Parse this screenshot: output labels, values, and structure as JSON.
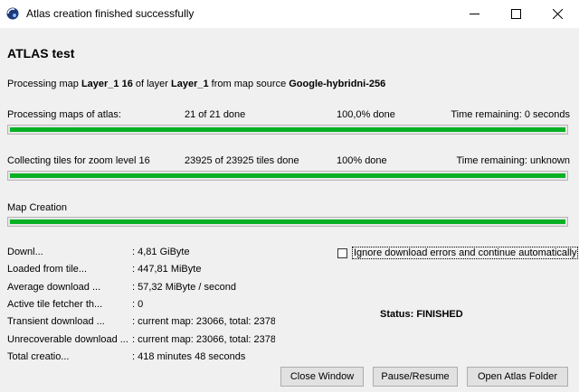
{
  "window": {
    "title": "Atlas creation finished successfully"
  },
  "atlas": {
    "heading": "ATLAS test",
    "processing_prefix": "Processing map ",
    "map_name": "Layer_1 16",
    "of_layer": " of layer ",
    "layer_name": "Layer_1",
    "from_source": " from map source ",
    "source_name": "Google-hybridni-256"
  },
  "progress": {
    "maps": {
      "label": "Processing maps of atlas:",
      "count": "21 of 21 done",
      "percent_text": "100,0% done",
      "remaining": "Time remaining: 0 seconds",
      "fill": 1.0
    },
    "tiles": {
      "label": "Collecting tiles for zoom level 16",
      "count": "23925 of 23925 tiles done",
      "percent_text": "100% done",
      "remaining": "Time remaining: unknown",
      "fill": 1.0
    },
    "creation": {
      "label": "Map Creation",
      "fill": 1.0
    }
  },
  "stats": [
    {
      "label": "Downl...",
      "value": ": 4,81 GiByte"
    },
    {
      "label": "Loaded from tile...",
      "value": ": 447,81 MiByte"
    },
    {
      "label": "Average download ...",
      "value": ": 57,32 MiByte / second"
    },
    {
      "label": "Active tile fetcher th...",
      "value": ": 0"
    },
    {
      "label": "Transient download ...",
      "value": ": current map: 23066, total: 2378"
    },
    {
      "label": "Unrecoverable download ...",
      "value": ": current map: 23066, total: 2378"
    },
    {
      "label": "Total creatio...",
      "value": ": 418 minutes 48 seconds"
    }
  ],
  "ignore_errors": {
    "label": "Ignore download errors and continue automatically",
    "checked": false
  },
  "status": "Status: FINISHED",
  "buttons": {
    "close": "Close Window",
    "pause": "Pause/Resume",
    "open_folder": "Open Atlas Folder"
  },
  "colors": {
    "progress_fill": "#06b025",
    "window_bg": "#f0f0f0"
  }
}
